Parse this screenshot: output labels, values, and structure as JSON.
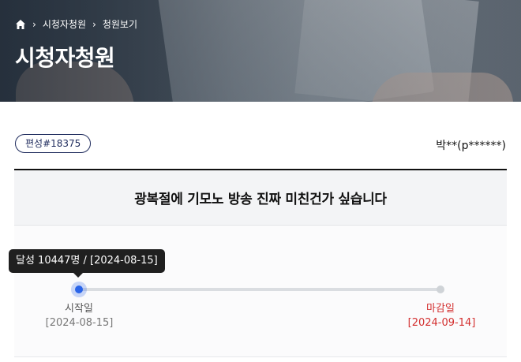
{
  "breadcrumb": {
    "home_icon": "home-icon",
    "items": [
      "시청자청원",
      "청원보기"
    ]
  },
  "page_title": "시청자청원",
  "petition": {
    "tag": "편성#18375",
    "author": "박**(p******)",
    "title": "광복절에 기모노 방송 진짜 미친건가 싶습니다"
  },
  "progress": {
    "tooltip": "달성 10447명 / [2024-08-15]",
    "fraction": 0.0,
    "start_label": "시작일",
    "start_date": "[2024-08-15]",
    "end_label": "마감일",
    "end_date": "[2024-09-14]"
  },
  "colors": {
    "accent": "#2a64e8",
    "tag_border": "#1d2a5c",
    "deadline": "#d32f2f"
  }
}
